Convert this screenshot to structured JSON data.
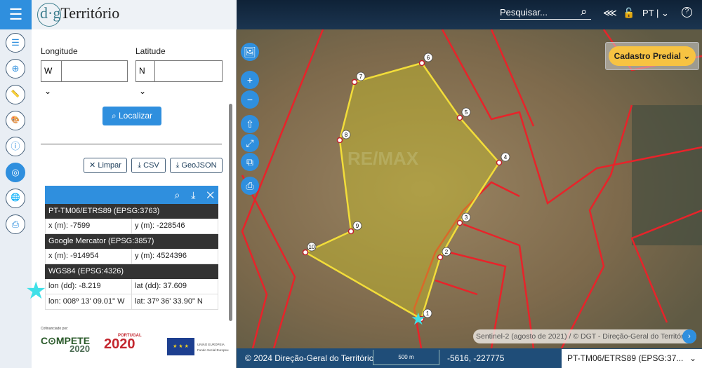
{
  "app": {
    "logo_prefix": "d·g",
    "logo_text": "Território",
    "menu_icon": "hamburger-icon"
  },
  "sidebar": {
    "items": [
      {
        "icon": "list-icon",
        "glyph": "☰"
      },
      {
        "icon": "add-icon",
        "glyph": "⊕"
      },
      {
        "icon": "ruler-icon",
        "glyph": "📏"
      },
      {
        "icon": "palette-icon",
        "glyph": "🎨"
      },
      {
        "icon": "info-icon",
        "glyph": "ⓘ"
      },
      {
        "icon": "target-icon",
        "glyph": "◎",
        "active": true
      },
      {
        "icon": "globe-icon",
        "glyph": "🌐"
      },
      {
        "icon": "print-icon",
        "glyph": "⎙"
      }
    ]
  },
  "locate": {
    "longitude_label": "Longitude",
    "latitude_label": "Latitude",
    "lon_hemisphere": "W ⌄",
    "lat_hemisphere": "N ⌄",
    "lon_value": "",
    "lat_value": "",
    "button": "⌕ Localizar",
    "clear": "✕ Limpar",
    "csv": "⤓ CSV",
    "geojson": "⤓ GeoJSON"
  },
  "coords": {
    "toolbar": "⌕ ⤓ ✕",
    "sections": [
      {
        "title": "PT-TM06/ETRS89 (EPSG:3763)",
        "rows": [
          [
            "x (m): -7599",
            "y (m): -228546"
          ]
        ]
      },
      {
        "title": "Google Mercator (EPSG:3857)",
        "rows": [
          [
            "x (m): -914954",
            "y (m): 4524396"
          ]
        ]
      },
      {
        "title": "WGS84 (EPSG:4326)",
        "rows": [
          [
            "lon (dd): -8.219",
            "lat (dd): 37.609"
          ],
          [
            "lon: 008º 13' 09.01\" W",
            "lat: 37º 36' 33.90\" N"
          ]
        ]
      }
    ]
  },
  "funding": {
    "label": "Cofinanciado por:",
    "compete": "C⊙MPETE",
    "compete_year": "2020",
    "portugal": "PORTUGAL",
    "portugal_year": "2020",
    "eu_line1": "UNIÃO EUROPEIA",
    "eu_line2": "Fundo Social Europeu"
  },
  "topbar": {
    "search_placeholder": "Pesquisar...",
    "language": "PT | ⌄",
    "share": "⋘",
    "lock": "🔓",
    "help": "?"
  },
  "map": {
    "layer_select": "Cadastro Predial ⌄",
    "attribution": "Sentinel-2 (agosto de 2021) / © DGT - Direção-Geral do Território",
    "attribution_toggle": "›",
    "controls": [
      "🖼",
      "+",
      "−",
      "⇧",
      "⤢",
      "⧉",
      "⎙"
    ],
    "vertices": [
      "1",
      "2",
      "3",
      "4",
      "5",
      "6",
      "7",
      "8",
      "9",
      "10"
    ],
    "polygon_color": "#f2dd3a",
    "parcel_color": "#e8232a",
    "watermark": "RE/MAX"
  },
  "bottombar": {
    "copyright": "© 2024 Direção-Geral do Território",
    "scale": "500 m",
    "cursor_coords": "-5616, -227775",
    "projection": "PT-TM06/ETRS89 (EPSG:37...",
    "projection_chevron": "⌄"
  }
}
